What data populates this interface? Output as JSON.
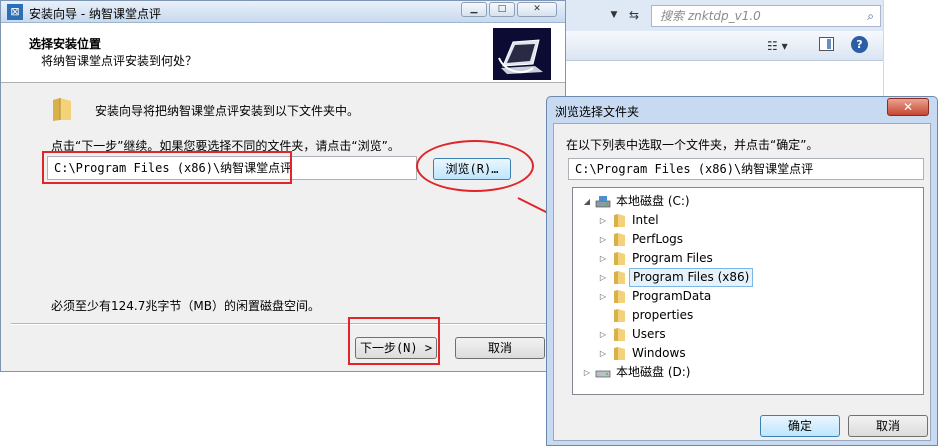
{
  "explorer": {
    "search_placeholder": "搜索 znktdp_v1.0",
    "icons": {
      "search": "magnifier-icon",
      "refresh": "refresh-icon",
      "views": "views-icon",
      "preview_pane": "preview-pane-icon",
      "help": "help-icon"
    }
  },
  "wizard": {
    "title": "安装向导 - 纳智课堂点评",
    "header_title": "选择安装位置",
    "header_subtitle": "将纳智课堂点评安装到何处？",
    "intro": "安装向导将把纳智课堂点评安装到以下文件夹中。",
    "hint": "点击“下一步”继续。如果您要选择不同的文件夹，请点击“浏览”。",
    "path_value": "C:\\Program Files (x86)\\纳智课堂点评",
    "browse_label": "浏览(R)…",
    "space_required": "必须至少有124.7兆字节（MB）的闲置磁盘空间。",
    "next_label": "下一步(N) >",
    "cancel_label": "取消"
  },
  "browse_dialog": {
    "title": "浏览选择文件夹",
    "instruction": "在以下列表中选取一个文件夹，并点击“确定”。",
    "selected_path": "C:\\Program Files (x86)\\纳智课堂点评",
    "tree": {
      "drive_c": "本地磁盘 (C:)",
      "folders": [
        "Intel",
        "PerfLogs",
        "Program Files",
        "Program Files (x86)",
        "ProgramData",
        "properties",
        "Users",
        "Windows"
      ],
      "selected_folder": "Program Files (x86)",
      "drive_d": "本地磁盘 (D:)"
    },
    "ok_label": "确定",
    "cancel_label": "取消"
  },
  "colors": {
    "highlight_red": "#e0262a",
    "selection_blue": "#7cb7e6",
    "folder_yellow": "#e8c25a"
  }
}
